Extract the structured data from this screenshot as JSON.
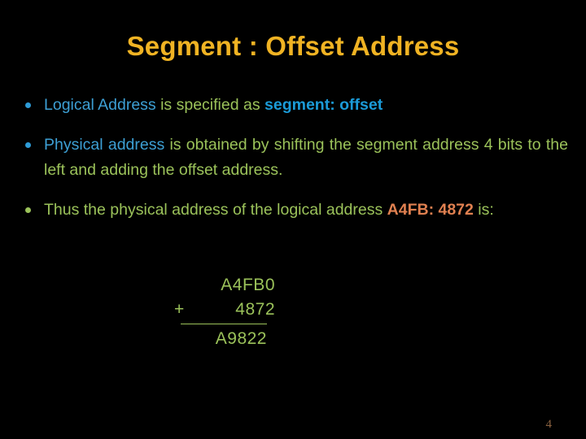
{
  "slide": {
    "title": "Segment : Offset Address",
    "background_color": "#000000",
    "title_color": "#F0B323",
    "page_number": "4",
    "page_number_color": "#8A6240"
  },
  "colors": {
    "blue": "#3D9FD4",
    "blue_bold": "#1B9BD8",
    "green": "#9BC25A",
    "salmon": "#E08050",
    "gold": "#F0B323"
  },
  "bullets": [
    {
      "marker_color": "#2E9BD6",
      "segments": [
        {
          "text": "Logical Address ",
          "style": "blue"
        },
        {
          "text": "is specified as ",
          "style": "green"
        },
        {
          "text": "segment: offset",
          "style": "blue-bold"
        }
      ]
    },
    {
      "marker_color": "#2E9BD6",
      "segments": [
        {
          "text": "Physical address ",
          "style": "blue"
        },
        {
          "text": "is obtained by shifting the segment address 4 bits to the left and adding the offset address.",
          "style": "green"
        }
      ]
    },
    {
      "marker_color": "#9BC25A",
      "segments": [
        {
          "text": "Thus the physical address of the logical address ",
          "style": "green"
        },
        {
          "text": "A4FB: 4872",
          "style": "salmon"
        },
        {
          "text": " is:",
          "style": "green"
        }
      ]
    }
  ],
  "arithmetic": {
    "color": "#9BC25A",
    "addend_1": "A4FB0",
    "operator": "+",
    "addend_2": "4872",
    "sum": "A9822"
  }
}
